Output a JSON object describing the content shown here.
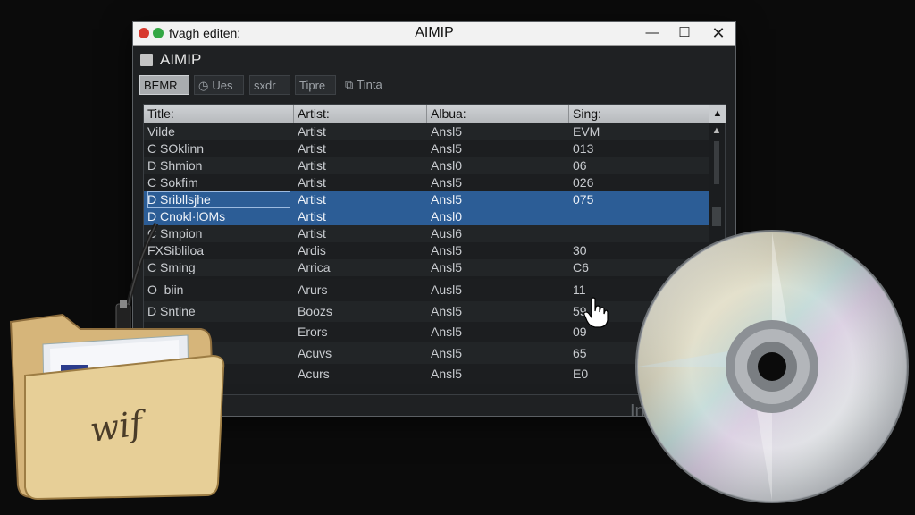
{
  "window": {
    "title_left": "fvagh editen:",
    "title": "AIMIP",
    "controls": {
      "minimize": "—",
      "maximize": "☐",
      "close": "✕"
    }
  },
  "app": {
    "name": "AIMIP"
  },
  "toolbar": {
    "buttons": [
      {
        "label": "BEMR",
        "icon": ""
      },
      {
        "label": "Ues",
        "icon": "timer-icon"
      },
      {
        "label": "sxdr",
        "icon": ""
      },
      {
        "label": "Tipre",
        "icon": ""
      },
      {
        "label": "Tinta",
        "icon": "film-icon"
      }
    ]
  },
  "table": {
    "columns": [
      "Title:",
      "Artist:",
      "Albua:",
      "Sing:"
    ],
    "sort_indicator": "▲",
    "rows": [
      {
        "title": "Vilde",
        "artist": "Artist",
        "album": "Ansl5",
        "song": "EVM"
      },
      {
        "title": "C SOklinn",
        "artist": "Artist",
        "album": "Ansl5",
        "song": "013"
      },
      {
        "title": "D Shmion",
        "artist": "Artist",
        "album": "Ansl0",
        "song": "06"
      },
      {
        "title": "C Sokfim",
        "artist": "Artist",
        "album": "Ansl5",
        "song": "026"
      },
      {
        "title": "D Sribllsjhe",
        "artist": "Artist",
        "album": "Ansl5",
        "song": "075",
        "selected": true
      },
      {
        "title": "D Cnokl·lOMs",
        "artist": "Artist",
        "album": "Ansl0",
        "song": "",
        "selected": true
      },
      {
        "title": "C Smpion",
        "artist": "Artist",
        "album": "Ausl6",
        "song": ""
      },
      {
        "title": "FXSibliloa",
        "artist": "Ardis",
        "album": "Ansl5",
        "song": "30"
      },
      {
        "title": "C Sming",
        "artist": "Arrica",
        "album": "Ansl5",
        "song": "C6"
      },
      {
        "title": "O–biin",
        "artist": "Arurs",
        "album": "Ausl5",
        "song": "11"
      },
      {
        "title": "D Sntine",
        "artist": "Boozs",
        "album": "Ansl5",
        "song": "59"
      },
      {
        "title": "",
        "artist": "Erors",
        "album": "Ansl5",
        "song": "09"
      },
      {
        "title": "",
        "artist": "Acuvs",
        "album": "Ansl5",
        "song": "65"
      },
      {
        "title": "",
        "artist": "Acurs",
        "album": "Ansl5",
        "song": "E0"
      }
    ]
  },
  "bottom_text": "In",
  "folder": {
    "label": "wif"
  },
  "colors": {
    "selection": "#2c5d96",
    "window_bg": "#1f2123",
    "header": "#c4c7ca"
  }
}
